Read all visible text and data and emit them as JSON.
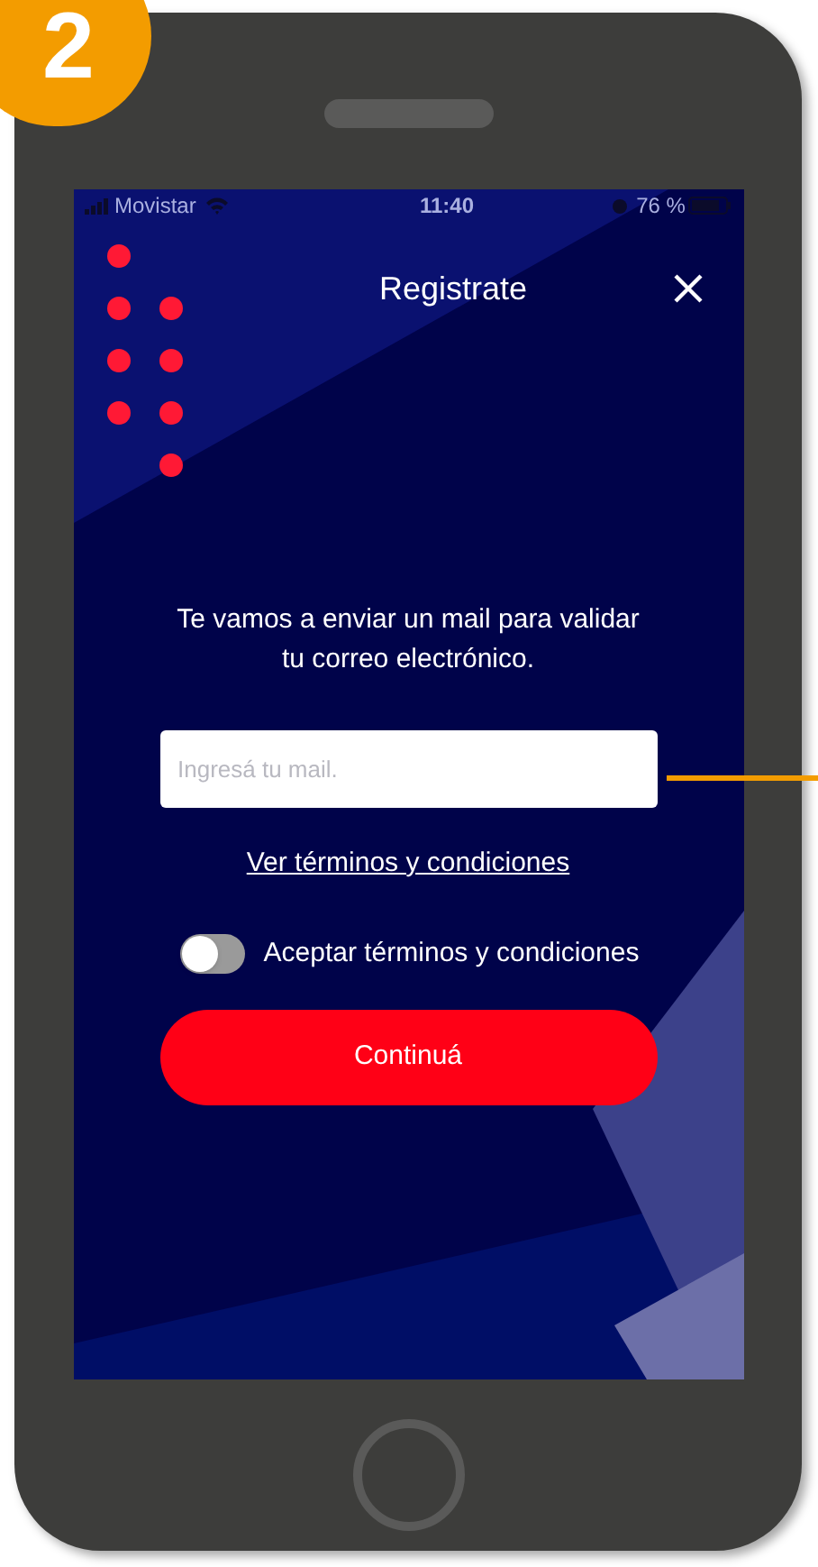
{
  "step_badge": {
    "number": "2"
  },
  "status_bar": {
    "carrier": "Movistar",
    "time": "11:40",
    "battery": "76 %"
  },
  "header": {
    "title": "Registrate"
  },
  "message": "Te vamos a enviar un mail para validar tu correo electrónico.",
  "email_field": {
    "placeholder": "Ingresá tu mail."
  },
  "terms_link": "Ver términos y condiciones",
  "terms_toggle": {
    "label": "Aceptar términos y condiciones",
    "on": false
  },
  "buttons": [
    "Continuá"
  ]
}
